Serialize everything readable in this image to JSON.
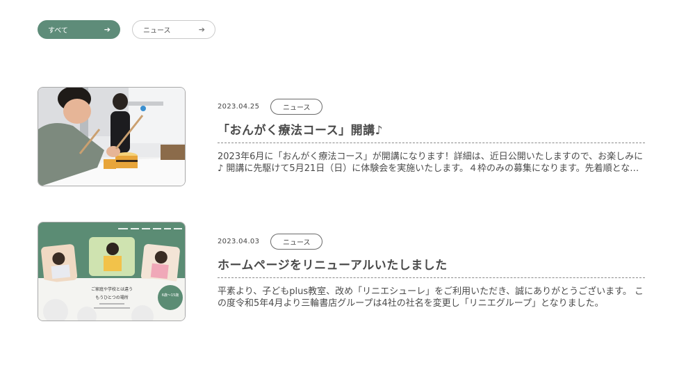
{
  "filters": [
    {
      "label": "すべて",
      "active": true,
      "icon": "arrow-right-icon"
    },
    {
      "label": "ニュース",
      "active": false,
      "icon": "arrow-right-icon"
    }
  ],
  "articles": [
    {
      "date": "2023.04.25",
      "category": "ニュース",
      "title": "「おんがく療法コース」開講♪",
      "excerpt": "2023年6月に「おんがく療法コース」が開講になります！詳細は、近日公開いたしますので、お楽しみに♪ 開講に先駆けて5月21日（日）に体験会を実施いたします。４枠のみの募集になります。先着順となります。",
      "thumbnail": "music-therapy-photo"
    },
    {
      "date": "2023.04.03",
      "category": "ニュース",
      "title": "ホームページをリニューアルいたしました",
      "excerpt": "平素より、子どもplus教室、改め「リニエシューレ」をご利用いただき、誠にありがとうございます。 この度令和5年4月より三輪書店グループは4社の社名を変更し「リニエグループ」となりました。",
      "thumbnail": "website-screenshot",
      "thumbnail_text": {
        "heading1": "ご家庭や学校とは違う",
        "heading2": "もうひとつの場所",
        "badge": "6歳〜15歳"
      }
    }
  ],
  "colors": {
    "accent": "#5e8c79",
    "text": "#4a4a4a"
  }
}
